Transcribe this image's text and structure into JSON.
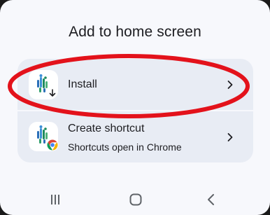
{
  "dialog": {
    "title": "Add to home screen",
    "options": [
      {
        "label": "Install",
        "icon": "pwa-app-icon-with-download-badge"
      },
      {
        "label": "Create shortcut",
        "sublabel": "Shortcuts open in Chrome",
        "icon": "pwa-app-icon-with-chrome-badge"
      }
    ]
  },
  "annotation": {
    "shape": "ellipse",
    "color": "#e3121b",
    "target": "Install"
  },
  "navbar": {
    "buttons": [
      "recents-icon",
      "home-icon",
      "back-icon"
    ]
  },
  "colors": {
    "sheet_background": "#f7f8fc",
    "options_background": "#e8ecf4",
    "text": "#1d1d21",
    "annotation": "#e3121b",
    "chrome_red": "#db4437",
    "chrome_green": "#0f9d58",
    "chrome_yellow": "#f4b400",
    "chrome_blue": "#4285f4"
  }
}
